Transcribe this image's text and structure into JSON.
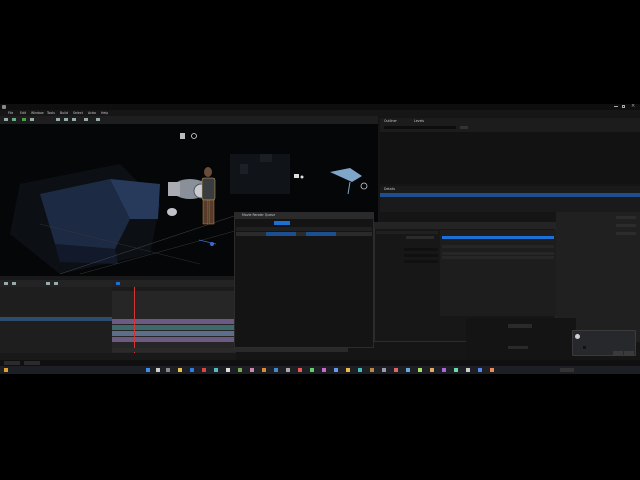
{
  "titlebar": {
    "doc_title": "",
    "window_controls": [
      "min",
      "max",
      "close"
    ]
  },
  "menubar": {
    "items": [
      "File",
      "Edit",
      "Window",
      "Tools",
      "Build",
      "Select",
      "Actor",
      "Help"
    ]
  },
  "viewport": {
    "mode_buttons": [
      "Perspective",
      "Lit",
      "Show"
    ],
    "actor_selected": "MetaHuman"
  },
  "outliner": {
    "tabs": [
      "Outliner",
      "Levels"
    ],
    "selected_row": ""
  },
  "details": {
    "tab": "Details",
    "selected_row": ""
  },
  "sequencer": {
    "track_labels": [
      "",
      "",
      "",
      "",
      "",
      "",
      "",
      "",
      ""
    ],
    "playhead_frame": ""
  },
  "movie_render_queue": {
    "title": "Movie Render Queue",
    "render_button": "",
    "columns": [
      "Job",
      "Settings",
      "Output"
    ],
    "job_row": ""
  },
  "preset_panel": {
    "title": "",
    "settings_header": "",
    "picker_items": [
      "",
      ""
    ],
    "picker_highlight": ""
  },
  "notification": {
    "text": "",
    "checkbox_label": "",
    "buttons": [
      "",
      ""
    ]
  },
  "taskbar": {
    "start": "start-icon",
    "search": "",
    "clock": ""
  },
  "colors": {
    "accent": "#1b6fd6",
    "sequencer_playhead": "#d33434",
    "track_purple": "#6a5a84",
    "track_teal": "#3e6a6e"
  }
}
